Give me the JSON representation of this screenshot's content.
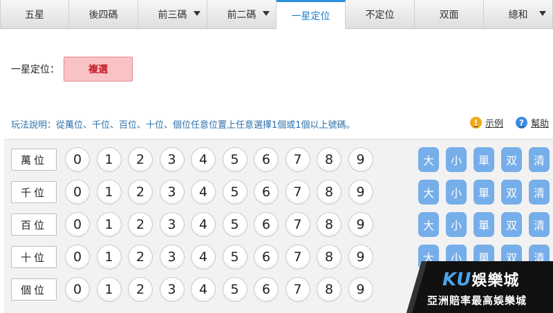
{
  "tabs": [
    {
      "label": "五星",
      "dropdown": false,
      "active": false
    },
    {
      "label": "後四碼",
      "dropdown": false,
      "active": false
    },
    {
      "label": "前三碼",
      "dropdown": true,
      "active": false
    },
    {
      "label": "前二碼",
      "dropdown": true,
      "active": false
    },
    {
      "label": "一星定位",
      "dropdown": false,
      "active": true
    },
    {
      "label": "不定位",
      "dropdown": false,
      "active": false
    },
    {
      "label": "双面",
      "dropdown": false,
      "active": false
    },
    {
      "label": "總和",
      "dropdown": true,
      "active": false
    }
  ],
  "mode": {
    "label": "一星定位：",
    "button": "複選"
  },
  "rules": {
    "text": "玩法說明：從萬位、千位、百位、十位、個位任意位置上任意選擇1個或1個以上號碼。"
  },
  "help": {
    "example": "示例",
    "help": "幫助"
  },
  "positions": [
    "萬位",
    "千位",
    "百位",
    "十位",
    "個位"
  ],
  "digits": [
    "0",
    "1",
    "2",
    "3",
    "4",
    "5",
    "6",
    "7",
    "8",
    "9"
  ],
  "quick_buttons": [
    "大",
    "小",
    "單",
    "双",
    "清"
  ],
  "banner": {
    "brand_latin": "KU",
    "brand_cn": "娛樂城",
    "subtitle": "亞洲賠率最高娛樂城"
  },
  "colors": {
    "accent": "#2a8fd8",
    "selected_bg": "#f9c3c6",
    "selected_text": "#c41a24",
    "quick_btn": "#76aee9"
  }
}
